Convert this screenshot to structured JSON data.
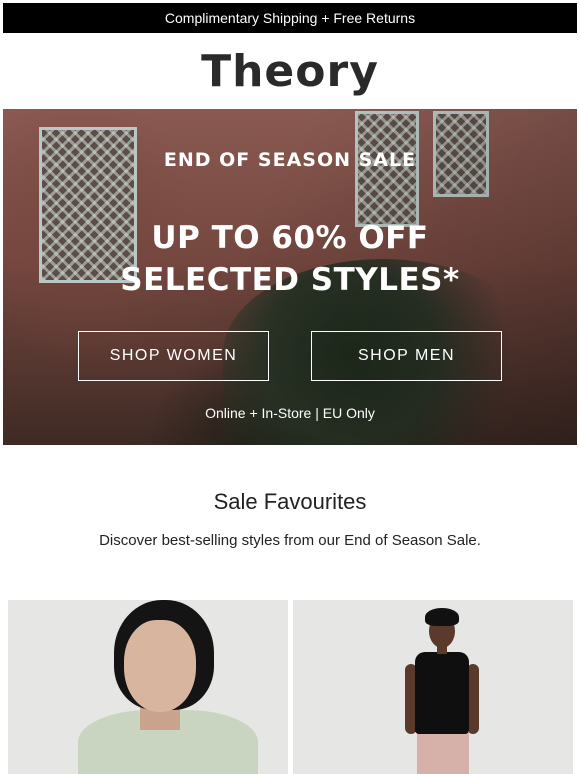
{
  "topbar": {
    "text": "Complimentary Shipping + Free Returns"
  },
  "brand": {
    "logo_text": "Theory"
  },
  "hero": {
    "kicker": "END OF SEASON SALE",
    "headline_line1": "UP TO 60% OFF",
    "headline_line2": "SELECTED STYLES*",
    "shop_women_label": "SHOP WOMEN",
    "shop_men_label": "SHOP MEN",
    "note": "Online + In-Store | EU Only"
  },
  "section": {
    "title": "Sale Favourites",
    "description": "Discover best-selling styles from our End of Season Sale."
  },
  "colors": {
    "topbar_bg": "#000000",
    "text_dark": "#222222",
    "hero_text": "#ffffff"
  }
}
